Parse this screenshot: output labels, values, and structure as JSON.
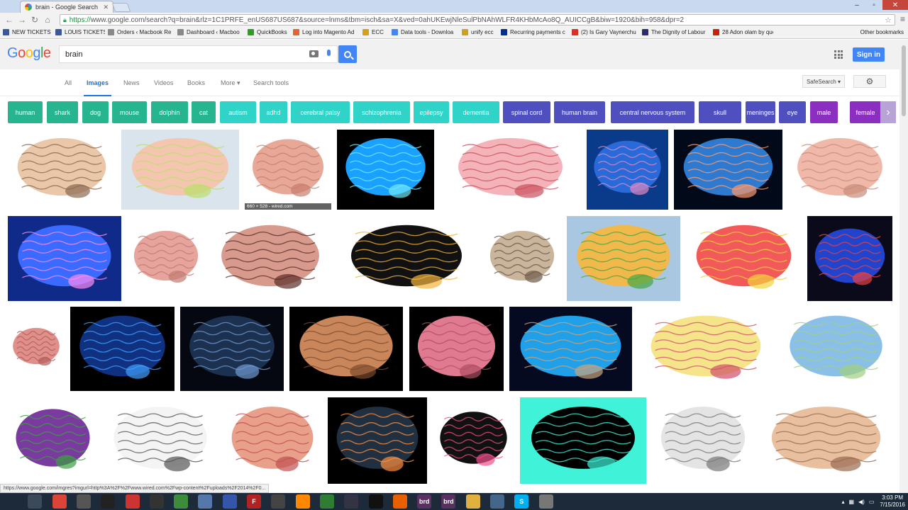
{
  "browser": {
    "tab_title": "brain - Google Search",
    "url_https": "https://",
    "url_rest": "www.google.com/search?q=brain&rlz=1C1PRFE_enUS687US687&source=lnms&tbm=isch&sa=X&ved=0ahUKEwjNleSulPbNAhWLFR4KHbMcAo8Q_AUICCgB&biw=1920&bih=958&dpr=2",
    "bookmarks": [
      {
        "label": "NEW TICKETS",
        "color": "#3b5998"
      },
      {
        "label": "LOUIS TICKETS",
        "color": "#3b5998"
      },
      {
        "label": "Orders ‹ Macbook Re",
        "color": "#888888"
      },
      {
        "label": "Dashboard ‹ Macboo",
        "color": "#888888"
      },
      {
        "label": "QuickBooks",
        "color": "#2ca01c"
      },
      {
        "label": "Log into Magento Ad",
        "color": "#e8622c"
      },
      {
        "label": "ECC",
        "color": "#d4a017"
      },
      {
        "label": "Data tools - Downloa",
        "color": "#4285f4"
      },
      {
        "label": "unify ecc",
        "color": "#d4a017"
      },
      {
        "label": "Recurring payments c",
        "color": "#003087"
      },
      {
        "label": "(2) Is Gary Vaynerchu",
        "color": "#d93025"
      },
      {
        "label": "The Dignity of Labour",
        "color": "#2b2b7a"
      },
      {
        "label": "28 Adon olam by que",
        "color": "#cc2200"
      }
    ],
    "other_bookmarks": "Other bookmarks",
    "status_url": "https://www.google.com/imgres?imgurl=http%3A%2F%2Fwww.wired.com%2Fwp-content%2Fuploads%2F2014%2F0..."
  },
  "google": {
    "logo_letters": [
      {
        "ch": "G",
        "color": "#4285f4"
      },
      {
        "ch": "o",
        "color": "#ea4335"
      },
      {
        "ch": "o",
        "color": "#fbbc05"
      },
      {
        "ch": "g",
        "color": "#4285f4"
      },
      {
        "ch": "l",
        "color": "#34a853"
      },
      {
        "ch": "e",
        "color": "#ea4335"
      }
    ],
    "query": "brain",
    "signin_label": "Sign in",
    "tabs": [
      "All",
      "Images",
      "News",
      "Videos",
      "Books",
      "More ▾",
      "Search tools"
    ],
    "active_tab": "Images",
    "safesearch_label": "SafeSearch ▾",
    "chips": [
      {
        "label": "human",
        "color": "#26b58e"
      },
      {
        "label": "shark",
        "color": "#26b58e"
      },
      {
        "label": "dog",
        "color": "#26b58e"
      },
      {
        "label": "mouse",
        "color": "#26b58e"
      },
      {
        "label": "dolphin",
        "color": "#26b58e"
      },
      {
        "label": "cat",
        "color": "#26b58e"
      },
      {
        "label": "autism",
        "color": "#2fd3c8"
      },
      {
        "label": "adhd",
        "color": "#2fd3c8"
      },
      {
        "label": "cerebral palsy",
        "color": "#2fd3c8"
      },
      {
        "label": "schizophrenia",
        "color": "#2fd3c8"
      },
      {
        "label": "epilepsy",
        "color": "#2fd3c8"
      },
      {
        "label": "dementia",
        "color": "#2fd3c8"
      },
      {
        "label": "spinal cord",
        "color": "#4f4fc0"
      },
      {
        "label": "human brain",
        "color": "#4f4fc0"
      },
      {
        "label": "central nervous system",
        "color": "#4f4fc0"
      },
      {
        "label": "skull",
        "color": "#4f4fc0"
      },
      {
        "label": "meninges",
        "color": "#4f4fc0"
      },
      {
        "label": "eye",
        "color": "#4f4fc0"
      },
      {
        "label": "male",
        "color": "#8a2fbf"
      },
      {
        "label": "female",
        "color": "#8a2fbf"
      }
    ],
    "hover_caption": "660 × 528 - wired.com",
    "images": [
      {
        "kind": "sagittal-illustration",
        "bg": "#ffffff"
      },
      {
        "kind": "labeled-lobes-diagram",
        "bg": "#d9e4ec"
      },
      {
        "kind": "pink-brain",
        "bg": "#ffffff"
      },
      {
        "kind": "blue-neon-brain",
        "bg": "#000000"
      },
      {
        "kind": "top-view-red-brain",
        "bg": "#ffffff"
      },
      {
        "kind": "head-silhouette-blue",
        "bg": "#0a3a8a"
      },
      {
        "kind": "xray-head-glow",
        "bg": "#020a1a"
      },
      {
        "kind": "pink-brain-side",
        "bg": "#ffffff"
      },
      {
        "kind": "glowing-brain-head",
        "bg": "#102a8a"
      },
      {
        "kind": "small-pink-brain",
        "bg": "#ffffff"
      },
      {
        "kind": "large-pink-brain",
        "bg": "#ffffff"
      },
      {
        "kind": "colorful-silhouette",
        "bg": "#ffffff"
      },
      {
        "kind": "underside-brain",
        "bg": "#ffffff"
      },
      {
        "kind": "brain-nervous-system-chart",
        "bg": "#a9c7e0"
      },
      {
        "kind": "colored-lobes-labeled",
        "bg": "#ffffff"
      },
      {
        "kind": "multicolor-head-dark",
        "bg": "#0a0a1a"
      },
      {
        "kind": "pink-brain-stem",
        "bg": "#ffffff"
      },
      {
        "kind": "blue-wire-brain",
        "bg": "#000000"
      },
      {
        "kind": "xray-blue-brain",
        "bg": "#050810"
      },
      {
        "kind": "realistic-tan-brain",
        "bg": "#000000"
      },
      {
        "kind": "pink-realistic-brain",
        "bg": "#000000"
      },
      {
        "kind": "hands-blue-brain",
        "bg": "#050a20"
      },
      {
        "kind": "sagittal-labeled-yellow",
        "bg": "#ffffff"
      },
      {
        "kind": "lateral-view-labeled",
        "bg": "#ffffff"
      },
      {
        "kind": "lobes-color-labeled",
        "bg": "#ffffff"
      },
      {
        "kind": "sketch-brain",
        "bg": "#ffffff"
      },
      {
        "kind": "midline-brain",
        "bg": "#ffffff"
      },
      {
        "kind": "neurons-glow-brain",
        "bg": "#000000"
      },
      {
        "kind": "colorful-icons-head",
        "bg": "#ffffff"
      },
      {
        "kind": "cyan-head-icon",
        "bg": "#3ff2d8"
      },
      {
        "kind": "gray-sketch-brain",
        "bg": "#ffffff"
      },
      {
        "kind": "labeled-brain-sagittal",
        "bg": "#ffffff"
      }
    ]
  },
  "taskbar": {
    "apps": [
      {
        "label": "",
        "color": "#1c2a3a",
        "name": "start-button"
      },
      {
        "label": "",
        "color": "#3a4a5a",
        "name": "task-view"
      },
      {
        "label": "",
        "color": "#db4437",
        "name": "chrome"
      },
      {
        "label": "",
        "color": "#555555",
        "name": "app-3"
      },
      {
        "label": "",
        "color": "#222222",
        "name": "app-obs"
      },
      {
        "label": "",
        "color": "#cc3333",
        "name": "app-5"
      },
      {
        "label": "",
        "color": "#333333",
        "name": "app-6"
      },
      {
        "label": "",
        "color": "#3c8c3c",
        "name": "app-7"
      },
      {
        "label": "",
        "color": "#5577aa",
        "name": "app-8"
      },
      {
        "label": "",
        "color": "#3355aa",
        "name": "app-9"
      },
      {
        "label": "F",
        "color": "#b22222",
        "name": "filezilla"
      },
      {
        "label": "",
        "color": "#444444",
        "name": "app-11"
      },
      {
        "label": "",
        "color": "#ff8800",
        "name": "vlc"
      },
      {
        "label": "",
        "color": "#2e7d32",
        "name": "excel"
      },
      {
        "label": "",
        "color": "#333344",
        "name": "app-14"
      },
      {
        "label": "",
        "color": "#111111",
        "name": "cmd"
      },
      {
        "label": "",
        "color": "#e66000",
        "name": "firefox"
      },
      {
        "label": "brd",
        "color": "#5a3060",
        "name": "brd-1"
      },
      {
        "label": "brd",
        "color": "#5a3060",
        "name": "brd-2"
      },
      {
        "label": "",
        "color": "#e0b040",
        "name": "explorer"
      },
      {
        "label": "",
        "color": "#446688",
        "name": "app-20"
      },
      {
        "label": "S",
        "color": "#00aff0",
        "name": "skype"
      },
      {
        "label": "",
        "color": "#777777",
        "name": "app-22"
      }
    ],
    "time": "3:03 PM",
    "date": "7/15/2016"
  }
}
